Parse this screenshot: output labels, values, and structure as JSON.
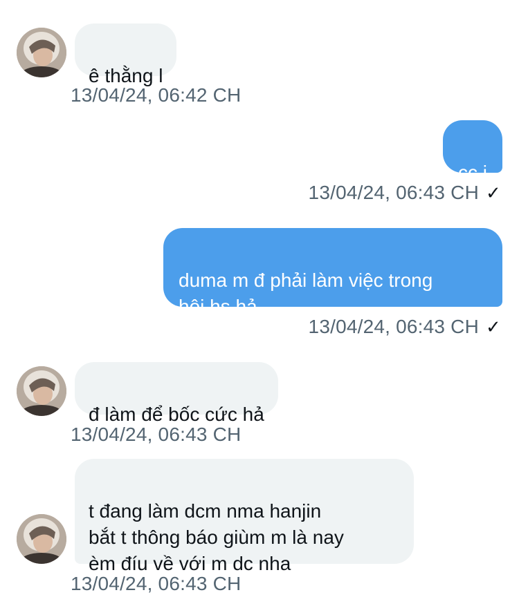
{
  "messages": [
    {
      "direction": "in",
      "text": "ê thằng l",
      "timestamp": "13/04/24, 06:42 CH"
    },
    {
      "direction": "out",
      "text": "cc j",
      "timestamp": "13/04/24, 06:43 CH",
      "status_icon": "check-icon"
    },
    {
      "direction": "out",
      "text": "duma m đ phải làm việc trong\nhội hs hả",
      "timestamp": "13/04/24, 06:43 CH",
      "status_icon": "check-icon"
    },
    {
      "direction": "in",
      "text": "đ làm để bốc cức hả",
      "timestamp": "13/04/24, 06:43 CH"
    },
    {
      "direction": "in",
      "text": "t đang làm dcm nma hanjin\nbắt t thông báo giùm m là nay\nèm đíu về với m dc nha",
      "timestamp": "13/04/24, 06:43 CH"
    }
  ],
  "status_glyph": "✓",
  "colors": {
    "incoming_bubble": "#eff3f4",
    "outgoing_bubble": "#4c9eeb",
    "timestamp": "#536471"
  }
}
